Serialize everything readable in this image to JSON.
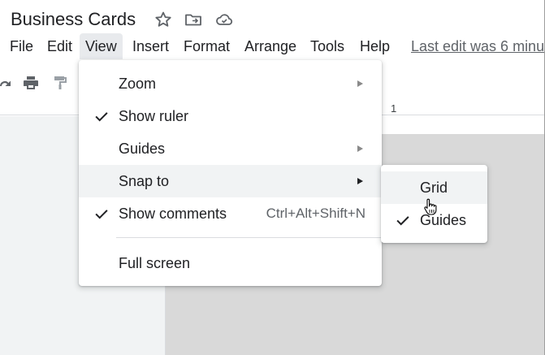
{
  "document": {
    "title": "Business Cards"
  },
  "title_icons": [
    "star-icon",
    "move-to-folder-icon",
    "cloud-saved-icon"
  ],
  "menubar": {
    "items": [
      {
        "label": "File"
      },
      {
        "label": "Edit"
      },
      {
        "label": "View",
        "active": true
      },
      {
        "label": "Insert"
      },
      {
        "label": "Format"
      },
      {
        "label": "Arrange"
      },
      {
        "label": "Tools"
      },
      {
        "label": "Help"
      }
    ],
    "last_edit": "Last edit was 6 minu"
  },
  "toolbar": {
    "icons": [
      "redo-icon",
      "print-icon",
      "paint-format-icon"
    ]
  },
  "ruler": {
    "label": "1"
  },
  "view_menu": {
    "items": [
      {
        "label": "Zoom",
        "checked": false,
        "submenu": true
      },
      {
        "label": "Show ruler",
        "checked": true,
        "submenu": false
      },
      {
        "label": "Guides",
        "checked": false,
        "submenu": true
      },
      {
        "label": "Snap to",
        "checked": false,
        "submenu": true,
        "highlighted": true
      },
      {
        "label": "Show comments",
        "checked": true,
        "shortcut": "Ctrl+Alt+Shift+N"
      },
      {
        "label": "Full screen",
        "checked": false
      }
    ]
  },
  "snap_submenu": {
    "items": [
      {
        "label": "Grid",
        "checked": false,
        "highlighted": true
      },
      {
        "label": "Guides",
        "checked": true
      }
    ]
  },
  "colors": {
    "menu_highlight": "#f1f3f4",
    "active_menu": "#e8eaed",
    "canvas": "#d9d9d9",
    "text": "#202124",
    "secondary_text": "#5f6368"
  }
}
